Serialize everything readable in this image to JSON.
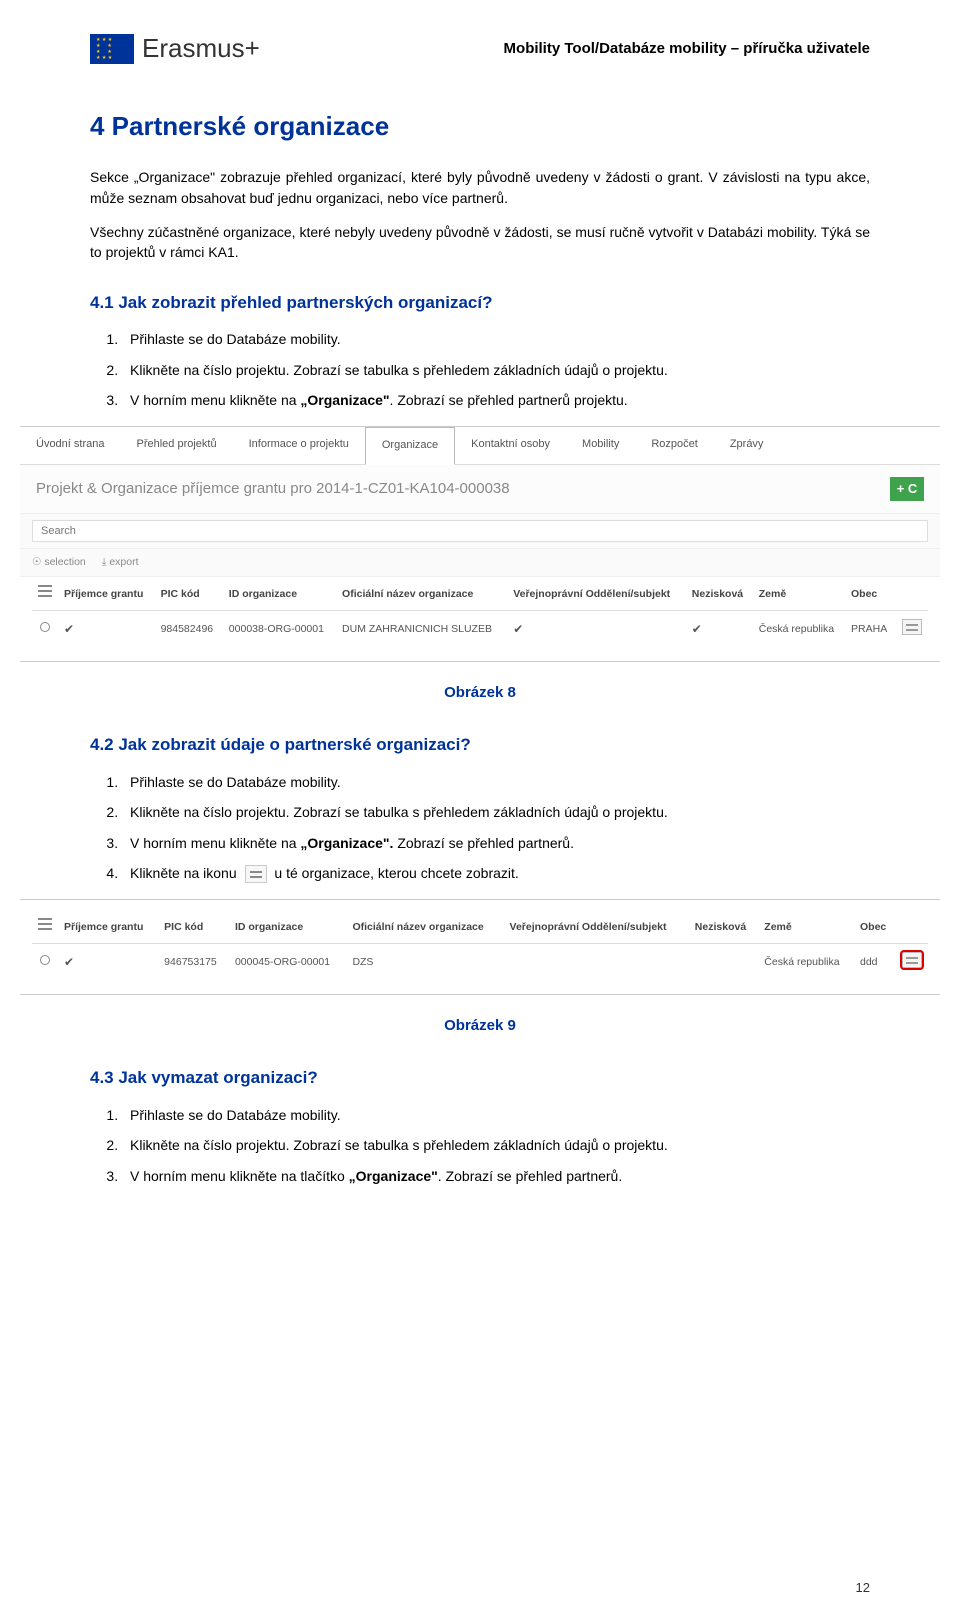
{
  "header": {
    "logo_text": "Erasmus+",
    "doc_title": "Mobility Tool/Databáze mobility – příručka uživatele"
  },
  "h1": "4  Partnerské organizace",
  "intro_p1": "Sekce „Organizace\" zobrazuje přehled organizací, které byly původně uvedeny v žádosti o grant. V závislosti na typu akce, může seznam obsahovat buď jednu organizaci, nebo více partnerů.",
  "intro_p2": "Všechny zúčastněné organizace, které nebyly uvedeny původně v žádosti, se musí ručně vytvořit v Databázi mobility. Týká se to projektů v rámci KA1.",
  "sec41": {
    "title": "4.1   Jak zobrazit přehled partnerských organizací?",
    "steps": [
      "Přihlaste se do Databáze mobility.",
      "Klikněte na číslo projektu. Zobrazí se tabulka s přehledem základních údajů o projektu.",
      {
        "pre": "V horním menu klikněte na ",
        "bold": "„Organizace\"",
        "post": ". Zobrazí se přehled partnerů projektu."
      }
    ]
  },
  "screenshot1": {
    "nav": [
      "Úvodní strana",
      "Přehled projektů",
      "Informace o projektu",
      "Organizace",
      "Kontaktní osoby",
      "Mobility",
      "Rozpočet",
      "Zprávy"
    ],
    "nav_active": 3,
    "project_title": "Projekt & Organizace příjemce grantu pro 2014-1-CZ01-KA104-000038",
    "add_label": "+ C",
    "search_placeholder": "Search",
    "tools": [
      "☉ selection",
      "⤓ export"
    ],
    "cols": [
      "",
      "Příjemce grantu",
      "PIC kód",
      "ID organizace",
      "Oficiální název organizace",
      "Veřejnoprávní Oddělení/subjekt",
      "Nezisková",
      "Země",
      "Obec",
      ""
    ],
    "row": {
      "prijemce": "✔",
      "pic": "984582496",
      "id": "000038-ORG-00001",
      "nazev": "DUM ZAHRANICNICH SLUZEB",
      "verej": "✔",
      "nezisk": "✔",
      "zeme": "Česká republika",
      "obec": "PRAHA"
    }
  },
  "caption1": "Obrázek 8",
  "sec42": {
    "title": "4.2   Jak zobrazit údaje o partnerské organizaci?",
    "steps": [
      "Přihlaste se do Databáze mobility.",
      "Klikněte na číslo projektu. Zobrazí se tabulka s přehledem základních údajů o projektu.",
      {
        "pre": "V horním menu klikněte na ",
        "bold": "„Organizace\".",
        "post": " Zobrazí se přehled partnerů."
      },
      {
        "pre": "Klikněte na ikonu ",
        "icon": true,
        "post": " u té organizace, kterou chcete zobrazit."
      }
    ]
  },
  "screenshot2": {
    "cols": [
      "",
      "Příjemce grantu",
      "PIC kód",
      "ID organizace",
      "Oficiální název organizace",
      "Veřejnoprávní Oddělení/subjekt",
      "Nezisková",
      "Země",
      "Obec",
      ""
    ],
    "row": {
      "prijemce": "✔",
      "pic": "946753175",
      "id": "000045-ORG-00001",
      "nazev": "DZS",
      "verej": "",
      "nezisk": "",
      "zeme": "Česká republika",
      "obec": "ddd"
    }
  },
  "caption2": "Obrázek 9",
  "sec43": {
    "title": "4.3   Jak vymazat organizaci?",
    "steps": [
      "Přihlaste se do Databáze mobility.",
      "Klikněte na číslo projektu. Zobrazí se tabulka s přehledem základních údajů o projektu.",
      {
        "pre": "V horním menu klikněte na tlačítko ",
        "bold": "„Organizace\"",
        "post": ". Zobrazí se přehled partnerů."
      }
    ]
  },
  "page_number": "12"
}
